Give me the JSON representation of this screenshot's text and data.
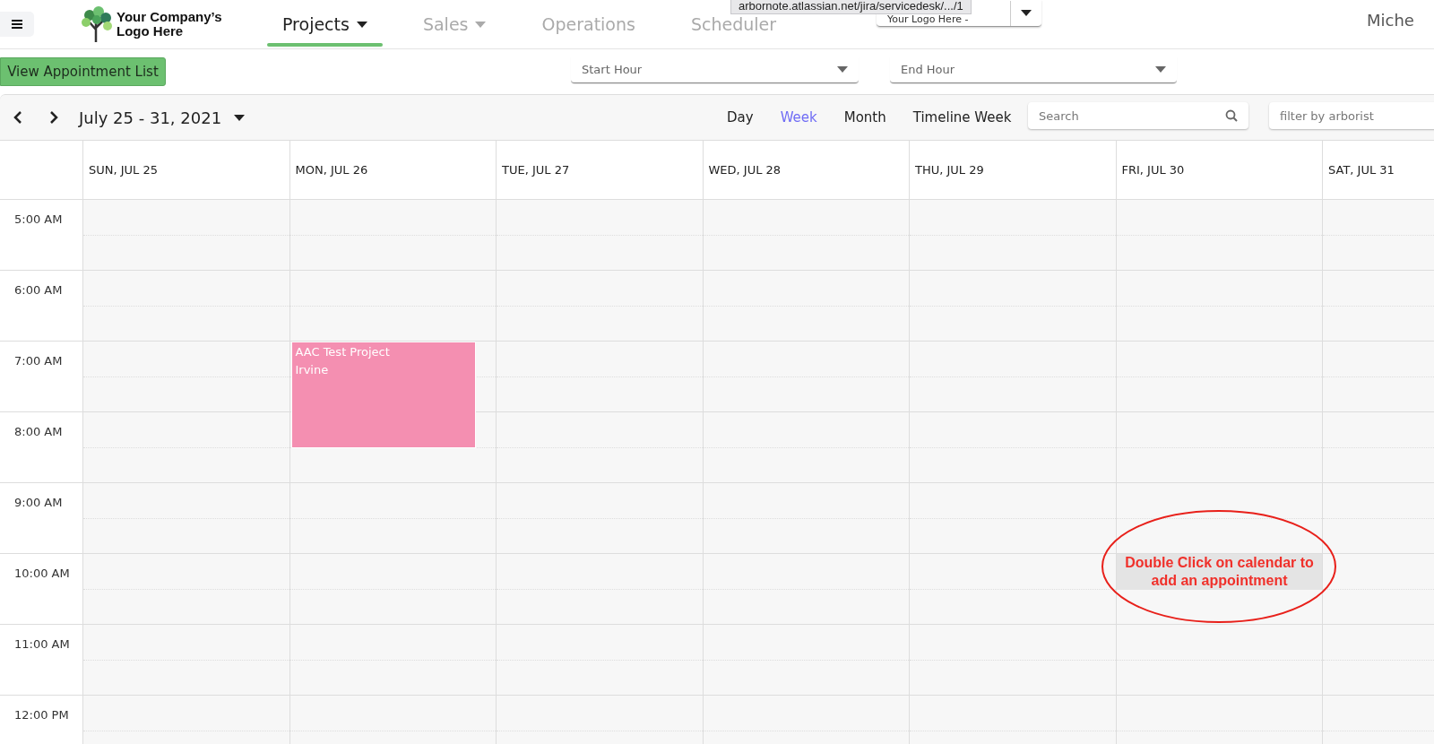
{
  "logo": {
    "text": "Your Company’s Logo Here"
  },
  "nav": [
    {
      "label": "Projects",
      "selected": true,
      "has_menu": true
    },
    {
      "label": "Sales",
      "selected": false,
      "has_menu": true
    },
    {
      "label": "Operations",
      "selected": false,
      "has_menu": false
    },
    {
      "label": "Scheduler",
      "selected": false,
      "has_menu": false
    }
  ],
  "logo_select": {
    "value": "Your Logo Here -"
  },
  "tooltip": "arbornote.atlassian.net/jira/servicedesk/.../1",
  "user": "Miche",
  "view_list_button": "View Appointment List",
  "start_hour": {
    "placeholder": "Start Hour"
  },
  "end_hour": {
    "placeholder": "End Hour"
  },
  "range": "July 25 - 31, 2021",
  "views": [
    {
      "label": "Day",
      "selected": false
    },
    {
      "label": "Week",
      "selected": true
    },
    {
      "label": "Month",
      "selected": false
    },
    {
      "label": "Timeline Week",
      "selected": false
    }
  ],
  "search": {
    "placeholder": "Search"
  },
  "filter": {
    "placeholder": "filter by arborist"
  },
  "times": [
    "5:00 AM",
    "6:00 AM",
    "7:00 AM",
    "8:00 AM",
    "9:00 AM",
    "10:00 AM",
    "11:00 AM",
    "12:00 PM"
  ],
  "days": [
    {
      "label": "SUN, JUL 25"
    },
    {
      "label": "MON, JUL 26",
      "appointments": [
        {
          "title": "AAC Test Project",
          "subtitle": "Irvine",
          "color": "#f48fb1"
        }
      ]
    },
    {
      "label": "TUE, JUL 27"
    },
    {
      "label": "WED, JUL 28"
    },
    {
      "label": "THU, JUL 29"
    },
    {
      "label": "FRI, JUL 30",
      "note": {
        "text": "Double Click on calendar to add an appointment"
      }
    },
    {
      "label": "SAT, JUL 31"
    }
  ]
}
